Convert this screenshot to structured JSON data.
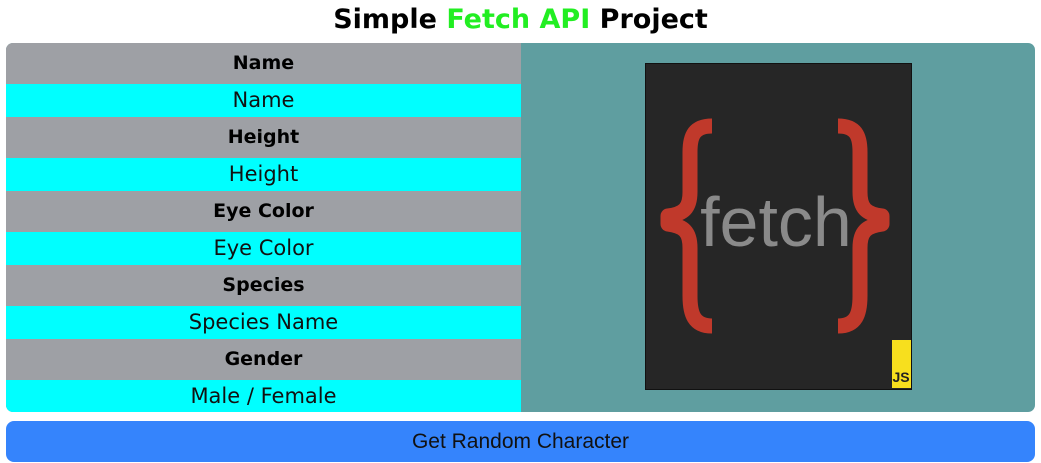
{
  "header": {
    "title_prefix": "Simple",
    "title_accent": "Fetch API",
    "title_suffix": "Project"
  },
  "fields": [
    {
      "label": "Name",
      "value": "Name"
    },
    {
      "label": "Height",
      "value": "Height"
    },
    {
      "label": "Eye Color",
      "value": "Eye Color"
    },
    {
      "label": "Species",
      "value": "Species Name"
    },
    {
      "label": "Gender",
      "value": "Male / Female"
    }
  ],
  "logo": {
    "text": "fetch",
    "badge": "JS"
  },
  "button": {
    "label": "Get Random Character"
  }
}
